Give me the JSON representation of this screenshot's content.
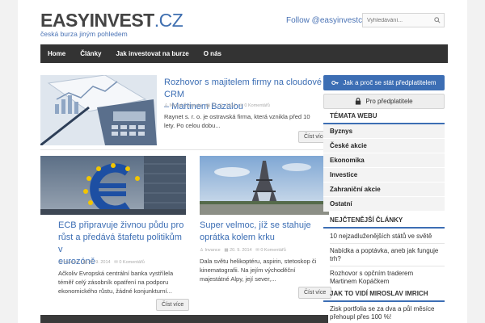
{
  "logo": {
    "easy": "EASYINVEST",
    "cz": ".CZ",
    "tagline": "česká burza jiným pohledem"
  },
  "header": {
    "follow": "Follow @easyinvestcz",
    "search_placeholder": "Vyhledávání..."
  },
  "nav": [
    "Home",
    "Články",
    "Jak investovat na burze",
    "O nás"
  ],
  "articles": [
    {
      "title_lines": [
        "Rozhovor s majitelem firmy na cloudové CRM",
        "– Martinem Bazalou"
      ],
      "meta": [
        "Michal Černecký",
        "27. 11. 2014",
        "0 Komentářů"
      ],
      "excerpt": [
        "Raynet s. r. o. je ostravská firma, která vznikla před 10",
        "lety. Po celou dobu..."
      ],
      "more": "Číst více"
    },
    {
      "title_lines": [
        "ECB připravuje živnou půdu pro",
        "růst a předává štafetu politikům v",
        "eurozóně"
      ],
      "meta": [
        "Invance",
        "22. 9. 2014",
        "0 Komentářů"
      ],
      "excerpt": [
        "Ačkoliv Evropská centrální banka vystřílela",
        "téměř celý zásobník opatření na podporu",
        "ekonomického růstu, žádné konjunkturní..."
      ],
      "more": "Číst více"
    },
    {
      "title_lines": [
        "Super velmoc, jíž se stahuje",
        "oprátka kolem krku"
      ],
      "meta": [
        "Invance",
        "20. 9. 2014",
        "0 Komentářů"
      ],
      "excerpt": [
        "Dala světu helikoptéru, aspirin, stetoskop či",
        "kinematografii. Na jejím východěční",
        "majestátné Alpy, její sever,..."
      ],
      "more": "Číst více"
    }
  ],
  "sidebar": {
    "subscribe": "Jak a proč se stát předplatitelem",
    "subscribers": "Pro předplatitele",
    "topics_title": "TÉMATA WEBU",
    "topics": [
      "Byznys",
      "České akcie",
      "Ekonomika",
      "Investice",
      "Zahraniční akcie",
      "Ostatní"
    ],
    "popular_title": "NEJČTENĚJŠÍ ČLÁNKY",
    "popular": [
      [
        "10 nejzadluženějších států ve světě"
      ],
      [
        "Nabídka a poptávka, aneb jak funguje",
        "trh?"
      ],
      [
        "Rozhovor s opčním traderem",
        "Martinem Kopáčkem"
      ]
    ],
    "miroslav_title": "JAK TO VIDÍ MIROSLAV IMRICH",
    "miroslav": [
      "Zisk portfolia se za dva a půl měsíce",
      "přehoupl přes 100 %!"
    ]
  },
  "colors": {
    "accent": "#3c6eb4",
    "nav_bg": "#333333"
  }
}
